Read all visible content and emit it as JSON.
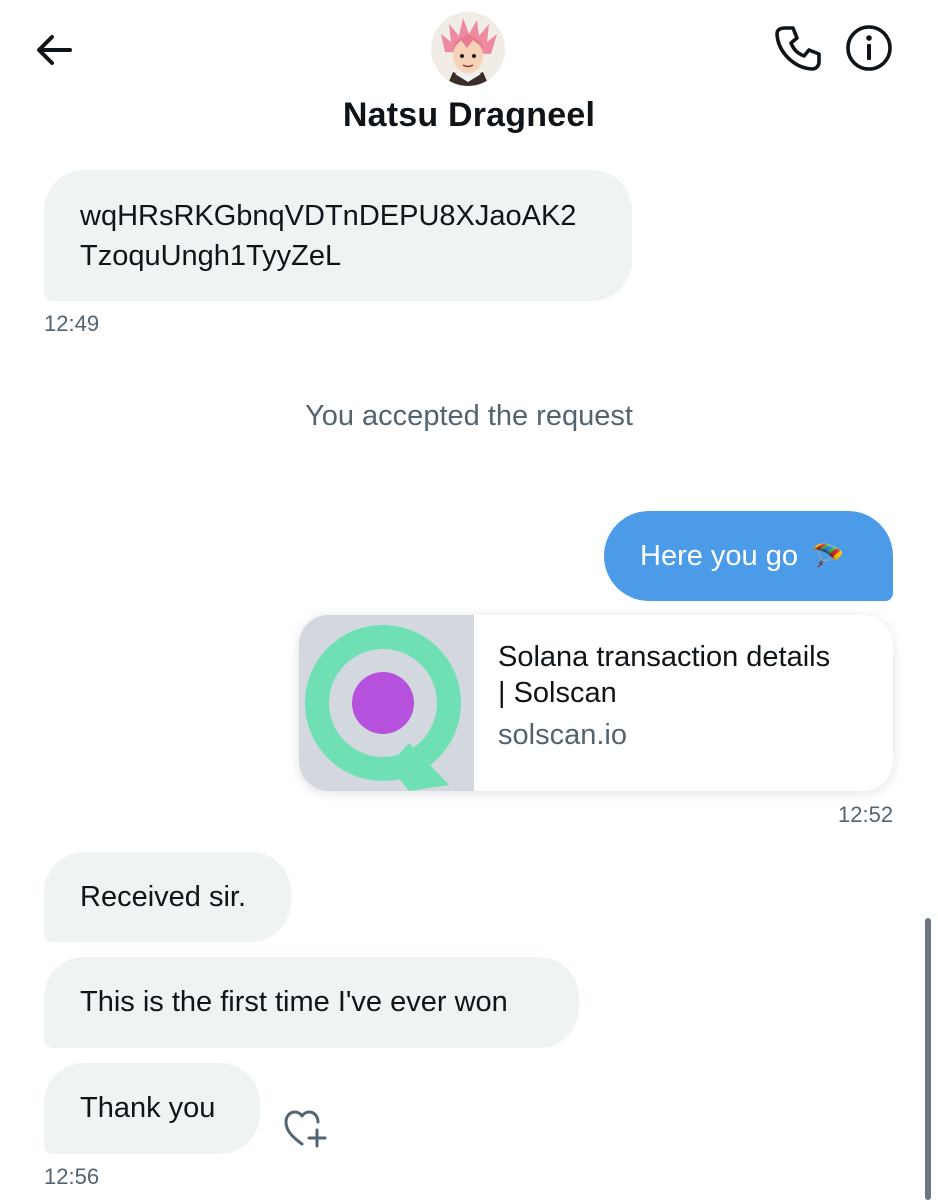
{
  "header": {
    "contact_name": "Natsu Dragneel",
    "back_icon": "arrow-left-icon",
    "call_icon": "phone-icon",
    "info_icon": "info-icon"
  },
  "messages": {
    "address": {
      "line1": "wqHRsRKGbnqVDTnDEPU8XJaoAK2",
      "line2": "TzoquUngh1TyyZeL",
      "time": "12:49"
    },
    "system": "You accepted the request",
    "outgoing": {
      "text": "Here you go",
      "emoji": "🪂"
    },
    "link_card": {
      "title_line1": "Solana transaction details",
      "title_line2": "| Solscan",
      "domain": "solscan.io",
      "time": "12:52"
    },
    "received": "Received sir.",
    "first_time": "This is the first time I've ever won",
    "thanks": "Thank you",
    "last_time": "12:56"
  },
  "colors": {
    "outgoing_bubble": "#4c9be8",
    "incoming_bubble": "#eff3f4",
    "secondary_text": "#536471",
    "solscan_green": "#6ee0b4",
    "solscan_purple": "#b651de"
  }
}
